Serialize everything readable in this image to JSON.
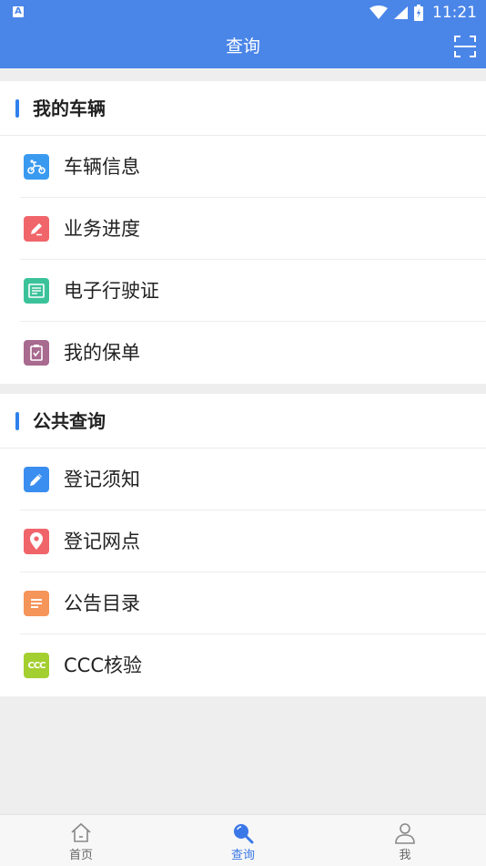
{
  "status_bar": {
    "notification_letter": "A",
    "time": "11:21"
  },
  "app_bar": {
    "title": "查询"
  },
  "sections": [
    {
      "title": "我的车辆",
      "items": [
        {
          "label": "车辆信息",
          "icon": "scooter-icon",
          "color": "#3a9af0"
        },
        {
          "label": "业务进度",
          "icon": "pencil-icon",
          "color": "#f0656a"
        },
        {
          "label": "电子行驶证",
          "icon": "license-card-icon",
          "color": "#3cc29a"
        },
        {
          "label": "我的保单",
          "icon": "insurance-clipboard-icon",
          "color": "#a86a8e"
        }
      ]
    },
    {
      "title": "公共查询",
      "items": [
        {
          "label": "登记须知",
          "icon": "edit-icon",
          "color": "#3a8ef0"
        },
        {
          "label": "登记网点",
          "icon": "location-pin-icon",
          "color": "#f0656a"
        },
        {
          "label": "公告目录",
          "icon": "document-list-icon",
          "color": "#f5955a"
        },
        {
          "label": "CCC核验",
          "icon": "ccc-badge-icon",
          "color": "#a4cf30",
          "badge_text": "CCC"
        }
      ]
    }
  ],
  "tab_bar": {
    "tabs": [
      {
        "label": "首页",
        "icon": "home-icon",
        "active": false
      },
      {
        "label": "查询",
        "icon": "search-icon",
        "active": true
      },
      {
        "label": "我",
        "icon": "person-icon",
        "active": false
      }
    ]
  },
  "colors": {
    "primary": "#4a85e8",
    "accent_bar": "#2f80ed",
    "active_tab": "#3b78e7",
    "background": "#eeeeee"
  }
}
